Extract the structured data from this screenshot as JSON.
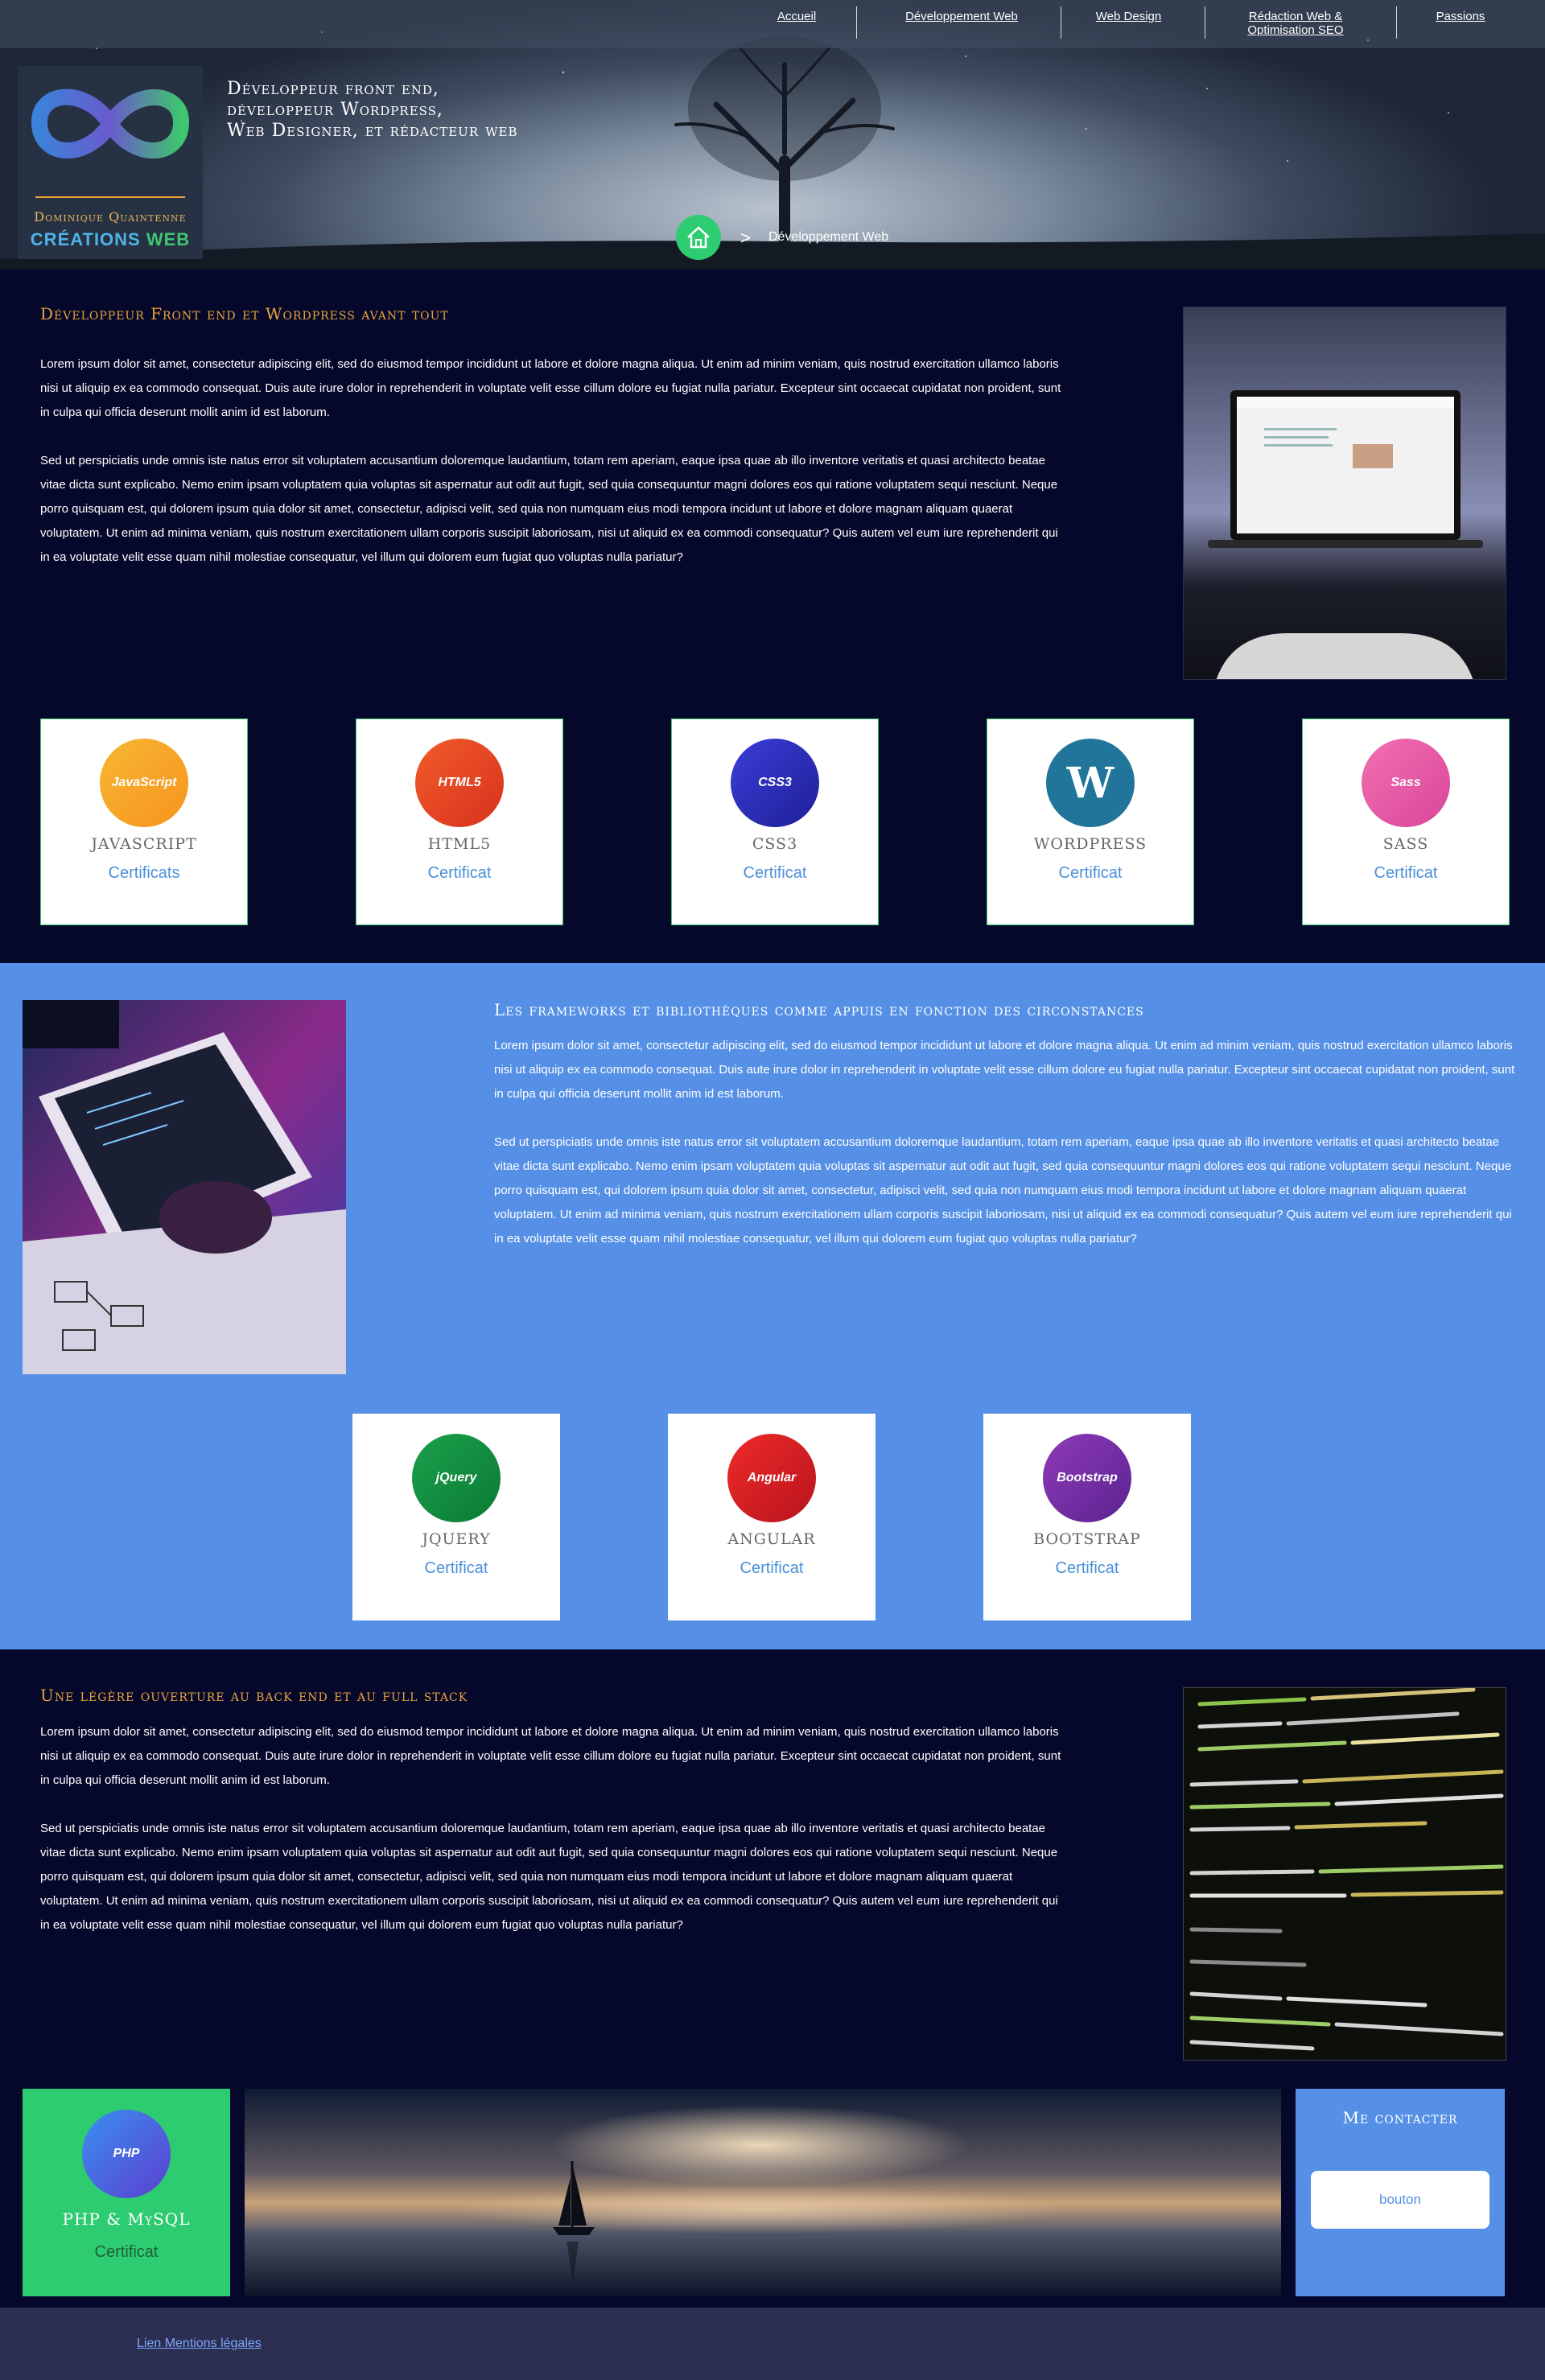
{
  "nav": {
    "items": [
      {
        "label": "Accueil"
      },
      {
        "label": "Développement Web"
      },
      {
        "label": "Web Design"
      },
      {
        "label": "Rédaction Web & Optimisation SEO"
      },
      {
        "label": "Passions"
      }
    ]
  },
  "brand": {
    "name": "Dominique Quaintenne",
    "sub_word1": "CRÉATIONS",
    "sub_word2": "WEB"
  },
  "tagline": {
    "line1": "Développeur front end,",
    "line2": "développeur Wordpress,",
    "line3": "Web Designer, et rédacteur web"
  },
  "breadcrumb": {
    "separator": ">",
    "current": "Développement Web"
  },
  "section1": {
    "title": "Développeur Front end et Wordpress avant tout",
    "p1": "Lorem ipsum dolor sit amet, consectetur adipiscing elit, sed do eiusmod tempor incididunt ut labore et dolore magna aliqua. Ut enim ad minim veniam, quis nostrud exercitation ullamco laboris nisi ut aliquip ex ea commodo consequat. Duis aute irure dolor in reprehenderit in voluptate velit esse cillum dolore eu fugiat nulla pariatur. Excepteur sint occaecat cupidatat non proident, sunt in culpa qui officia deserunt mollit anim id est laborum.",
    "p2": "Sed ut perspiciatis unde omnis iste natus error sit voluptatem accusantium doloremque laudantium, totam rem aperiam, eaque ipsa quae ab illo inventore veritatis et quasi architecto beatae vitae dicta sunt explicabo. Nemo enim ipsam voluptatem quia voluptas sit aspernatur aut odit aut fugit, sed quia consequuntur magni dolores eos qui ratione voluptatem sequi nesciunt. Neque porro quisquam est, qui dolorem ipsum quia dolor sit amet, consectetur, adipisci velit, sed quia non numquam eius modi tempora incidunt ut labore et dolore magnam aliquam quaerat voluptatem. Ut enim ad minima veniam, quis nostrum exercitationem ullam corporis suscipit laboriosam, nisi ut aliquid ex ea commodi consequatur? Quis autem vel eum iure reprehenderit qui in ea voluptate velit esse quam nihil molestiae consequatur, vel illum qui dolorem eum fugiat quo voluptas nulla pariatur?",
    "cards": [
      {
        "badge": "JavaScript",
        "name": "JAVASCRIPT",
        "cert": "Certificats",
        "color": "#f7931e"
      },
      {
        "badge": "HTML5",
        "name": "HTML5",
        "cert": "Certificat",
        "color": "#e8452a"
      },
      {
        "badge": "CSS3",
        "name": "CSS3",
        "cert": "Certificat",
        "color": "#2a2bb8"
      },
      {
        "badge": "W",
        "name": "WORDPRESS",
        "cert": "Certificat",
        "color": "#21759b"
      },
      {
        "badge": "Sass",
        "name": "SASS",
        "cert": "Certificat",
        "color": "#e94b9a"
      }
    ]
  },
  "section2": {
    "title": "Les frameworks et bibliothèques comme appuis en fonction des circonstances",
    "p1": "Lorem ipsum dolor sit amet, consectetur adipiscing elit, sed do eiusmod tempor incididunt ut labore et dolore magna aliqua. Ut enim ad minim veniam, quis nostrud exercitation ullamco laboris nisi ut aliquip ex ea commodo consequat. Duis aute irure dolor in reprehenderit in voluptate velit esse cillum dolore eu fugiat nulla pariatur. Excepteur sint occaecat cupidatat non proident, sunt in culpa qui officia deserunt mollit anim id est laborum.",
    "p2": "Sed ut perspiciatis unde omnis iste natus error sit voluptatem accusantium doloremque laudantium, totam rem aperiam, eaque ipsa quae ab illo inventore veritatis et quasi architecto beatae vitae dicta sunt explicabo. Nemo enim ipsam voluptatem quia voluptas sit aspernatur aut odit aut fugit, sed quia consequuntur magni dolores eos qui ratione voluptatem sequi nesciunt. Neque porro quisquam est, qui dolorem ipsum quia dolor sit amet, consectetur, adipisci velit, sed quia non numquam eius modi tempora incidunt ut labore et dolore magnam aliquam quaerat voluptatem. Ut enim ad minima veniam, quis nostrum exercitationem ullam corporis suscipit laboriosam, nisi ut aliquid ex ea commodi consequatur? Quis autem vel eum iure reprehenderit qui in ea voluptate velit esse quam nihil molestiae consequatur, vel illum qui dolorem eum fugiat quo voluptas nulla pariatur?",
    "cards": [
      {
        "badge": "jQuery",
        "name": "JQUERY",
        "cert": "Certificat",
        "color": "#0e8a3e"
      },
      {
        "badge": "Angular",
        "name": "ANGULAR",
        "cert": "Certificat",
        "color": "#d81f26"
      },
      {
        "badge": "Bootstrap",
        "name": "BOOTSTRAP",
        "cert": "Certificat",
        "color": "#7a2fa0"
      }
    ]
  },
  "section3": {
    "title": "Une légère ouverture au back end et au full stack",
    "p1": "Lorem ipsum dolor sit amet, consectetur adipiscing elit, sed do eiusmod tempor incididunt ut labore et dolore magna aliqua. Ut enim ad minim veniam, quis nostrud exercitation ullamco laboris nisi ut aliquip ex ea commodo consequat. Duis aute irure dolor in reprehenderit in voluptate velit esse cillum dolore eu fugiat nulla pariatur. Excepteur sint occaecat cupidatat non proident, sunt in culpa qui officia deserunt mollit anim id est laborum.",
    "p2": "Sed ut perspiciatis unde omnis iste natus error sit voluptatem accusantium doloremque laudantium, totam rem aperiam, eaque ipsa quae ab illo inventore veritatis et quasi architecto beatae vitae dicta sunt explicabo. Nemo enim ipsam voluptatem quia voluptas sit aspernatur aut odit aut fugit, sed quia consequuntur magni dolores eos qui ratione voluptatem sequi nesciunt. Neque porro quisquam est, qui dolorem ipsum quia dolor sit amet, consectetur, adipisci velit, sed quia non numquam eius modi tempora incidunt ut labore et dolore magnam aliquam quaerat voluptatem. Ut enim ad minima veniam, quis nostrum exercitationem ullam corporis suscipit laboriosam, nisi ut aliquid ex ea commodi consequatur? Quis autem vel eum iure reprehenderit qui in ea voluptate velit esse quam nihil molestiae consequatur, vel illum qui dolorem eum fugiat quo voluptas nulla pariatur?",
    "php_badge": "PHP",
    "php_name": "PHP & MySQL",
    "php_cert": "Certificat",
    "contact_title": "Me contacter",
    "contact_button": "bouton"
  },
  "footer": {
    "link": "Lien Mentions légales"
  },
  "colors": {
    "accent_gold": "#e8a33a",
    "nav_bg": "#05082a",
    "section_blue": "#5590e6",
    "green": "#2ecc71",
    "link_blue": "#4a90d9"
  }
}
